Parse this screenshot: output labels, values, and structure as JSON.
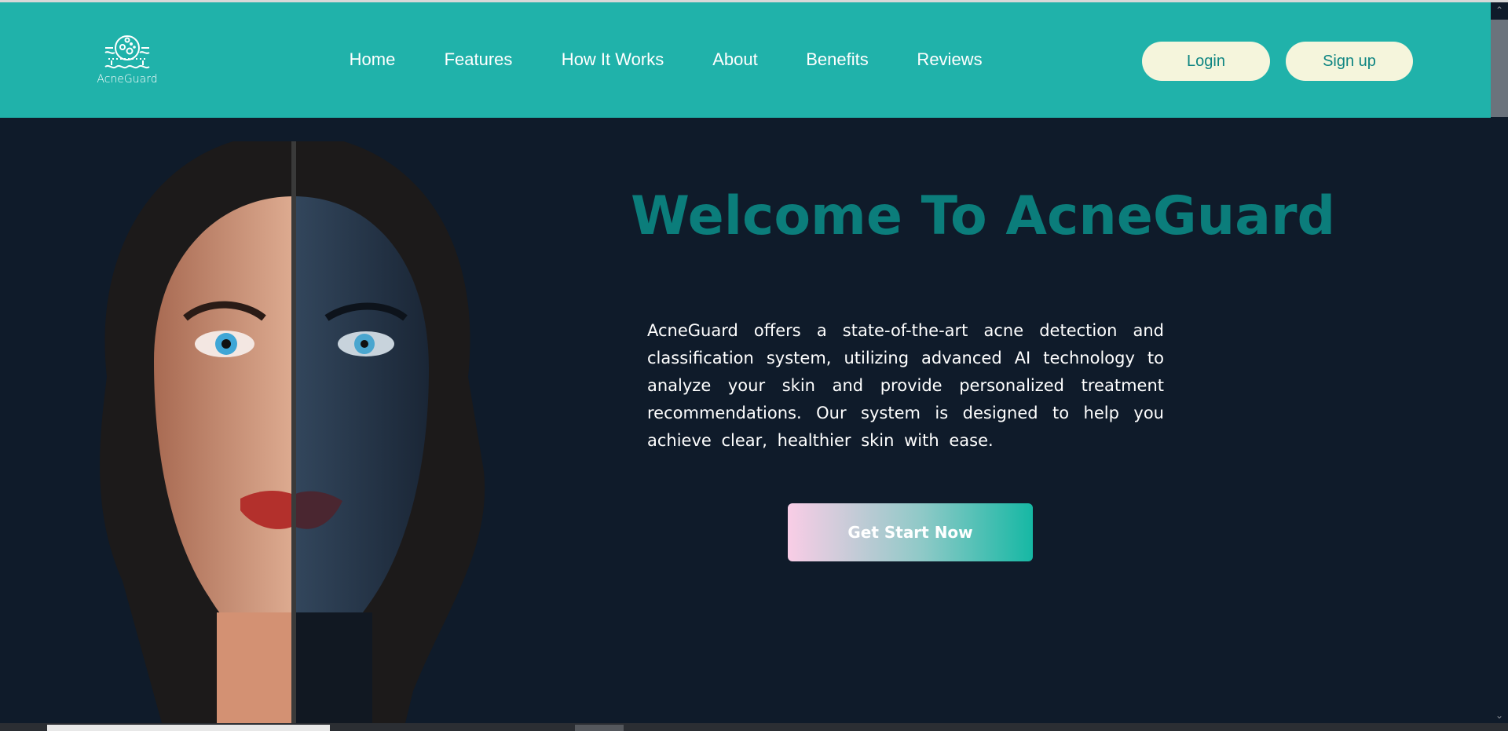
{
  "brand": {
    "name": "AcneGuard",
    "logo_icon": "acne-skin-icon"
  },
  "nav": {
    "items": [
      {
        "label": "Home"
      },
      {
        "label": "Features"
      },
      {
        "label": "How It Works"
      },
      {
        "label": "About"
      },
      {
        "label": "Benefits"
      },
      {
        "label": "Reviews"
      }
    ]
  },
  "auth": {
    "login_label": "Login",
    "signup_label": "Sign up"
  },
  "hero": {
    "title": "Welcome To AcneGuard",
    "description": "AcneGuard offers a state-of-the-art acne detection and classification system, utilizing advanced AI technology to analyze your skin and provide personalized treatment recommendations. Our system is designed to help you achieve clear, healthier skin with ease.",
    "cta_label": "Get Start Now",
    "image": "split-face-portrait"
  },
  "colors": {
    "header": "#20b2aa",
    "background": "#0f1b2a",
    "title": "#0b7d7b",
    "pill": "#f5f5dc"
  }
}
